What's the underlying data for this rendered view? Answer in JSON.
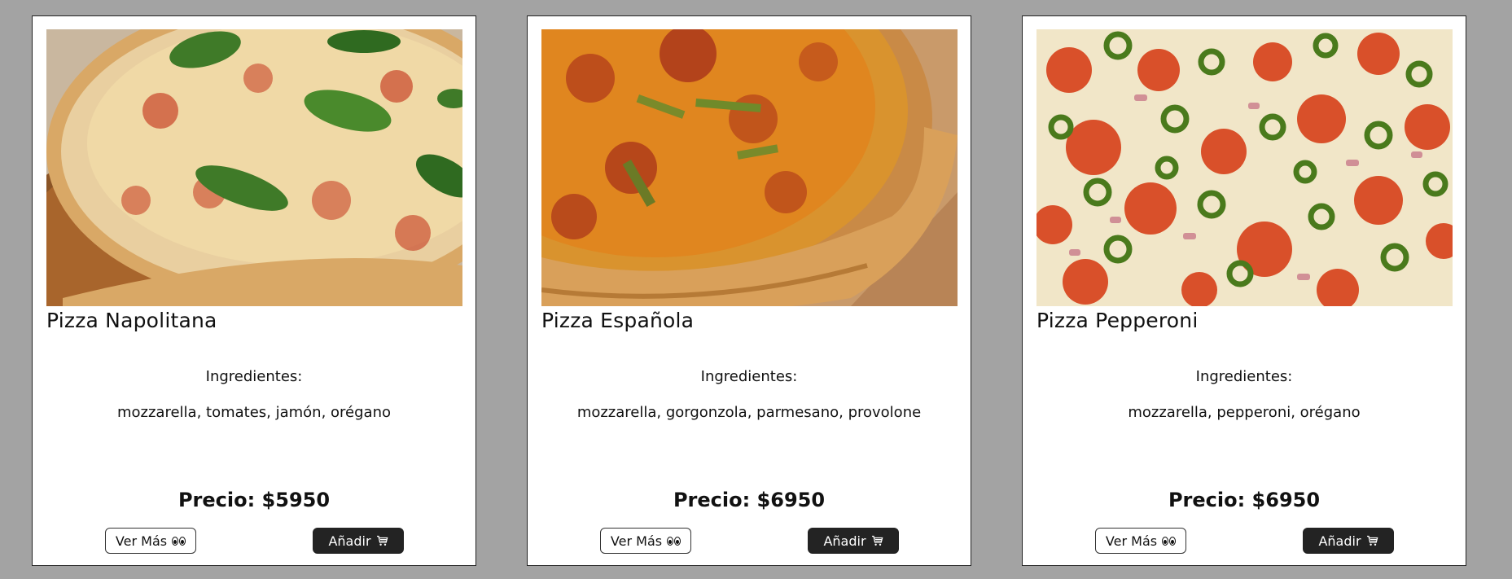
{
  "products": [
    {
      "name": "Pizza Napolitana",
      "ingredients_label": "Ingredientes:",
      "ingredients": "mozzarella, tomates, jamón, orégano",
      "price": "Precio: $5950",
      "more_label": "Ver Más",
      "add_label": "Añadir",
      "more_icon": "eyes-icon",
      "add_icon": "cart-icon"
    },
    {
      "name": "Pizza Española",
      "ingredients_label": "Ingredientes:",
      "ingredients": "mozzarella, gorgonzola, parmesano, provolone",
      "price": "Precio: $6950",
      "more_label": "Ver Más",
      "add_label": "Añadir",
      "more_icon": "eyes-icon",
      "add_icon": "cart-icon"
    },
    {
      "name": "Pizza Pepperoni",
      "ingredients_label": "Ingredientes:",
      "ingredients": "mozzarella, pepperoni, orégano",
      "price": "Precio: $6950",
      "more_label": "Ver Más",
      "add_label": "Añadir",
      "more_icon": "eyes-icon",
      "add_icon": "cart-icon"
    }
  ],
  "colors": {
    "background": "#a3a3a3",
    "card": "#ffffff",
    "add_button": "#232323"
  }
}
